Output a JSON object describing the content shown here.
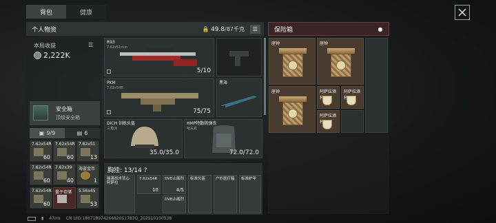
{
  "tabs": {
    "backpack": "背包",
    "health": "健康"
  },
  "personal": {
    "title": "个人物资",
    "weight_current": "49.8",
    "weight_max": "/87千克"
  },
  "earnings": {
    "label": "本局收获",
    "value": "2,222K"
  },
  "safe_case": {
    "title": "安全箱",
    "subtitle": "顶级安全箱"
  },
  "subtabs": {
    "ammo": "9/9",
    "other": "6"
  },
  "ammo": [
    {
      "name": "7.62x54R",
      "qty": "60"
    },
    {
      "name": "7.62x54R",
      "qty": "60"
    },
    {
      "name": "7.62x51",
      "qty": "13"
    },
    {
      "name": "7.62x54R",
      "qty": "60"
    },
    {
      "name": "7.62x39",
      "qty": "40"
    },
    {
      "name": "海盗金币",
      "qty": "1"
    },
    {
      "name": "7.62x54R",
      "qty": "60"
    },
    {
      "name": "量子存储",
      "qty": ""
    },
    {
      "name": "5.56x45",
      "qty": "53"
    }
  ],
  "weapons": {
    "primary": {
      "name": "R93",
      "sub": "7.62x51mm",
      "count": "5/10"
    },
    "secondary": {
      "name": "PKM",
      "sub": "7.62x54R",
      "count": "75/75"
    },
    "melee": {
      "name": "黑海"
    }
  },
  "helmet": {
    "name": "DICH 训练头盔",
    "sub": "三角洲",
    "value": "35.0/35.0"
  },
  "armor": {
    "name": "HMP特勤防弹衣",
    "sub": "哈夫克",
    "value": "72.0/72.0"
  },
  "chest": {
    "title": "胸挂: 13/14 ?",
    "items": [
      {
        "name": "强袭战术背心",
        "sub": "阿萨拉",
        "qty": ""
      },
      {
        "name": "7.62x54R",
        "qty": "10"
      },
      {
        "name": "DVE止痛剂",
        "qty": "4/5"
      },
      {
        "name": "标准头盔",
        "qty": ""
      },
      {
        "name": "户外医疗箱",
        "qty": ""
      },
      {
        "name": "标准护甲",
        "qty": ""
      }
    ],
    "extra": "DVE止痛剂"
  },
  "safe_box": {
    "title": "保险箱",
    "items": [
      {
        "name": "座钟"
      },
      {
        "name": "座钟"
      },
      {
        "name": "座钟"
      },
      {
        "name": "阿萨拉酒杯"
      },
      {
        "name": "阿萨拉酒杯"
      },
      {
        "name": "阿萨拉酒杯"
      }
    ]
  },
  "footer": {
    "ping": "47ms",
    "uid": "CN UID:18671897426682051783Q_202510100538"
  }
}
